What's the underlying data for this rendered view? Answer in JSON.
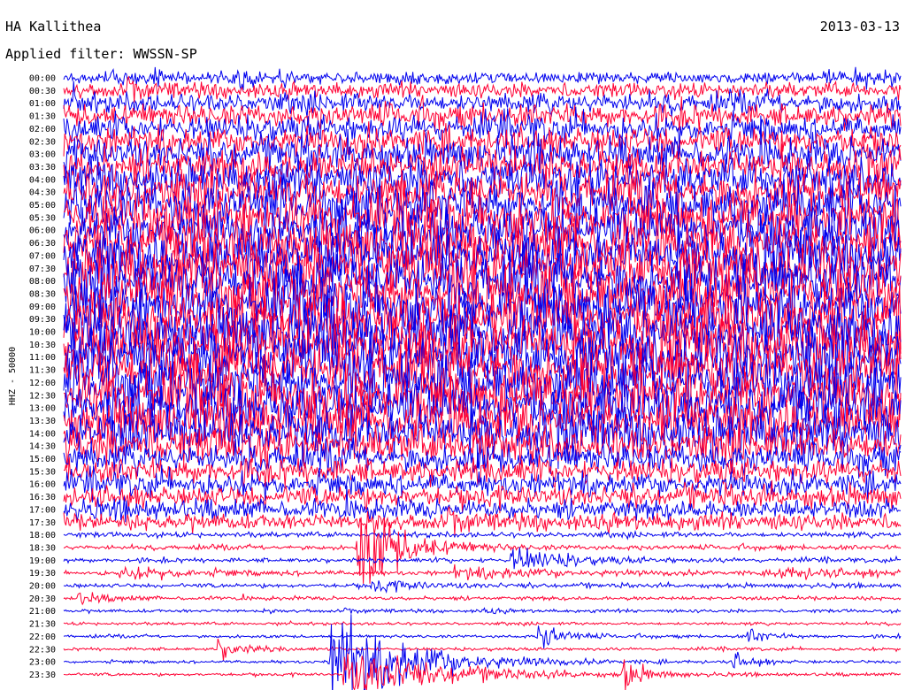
{
  "header": {
    "station": "HA Kallithea",
    "date": "2013-03-13",
    "filter": "Applied filter: WWSSN-SP"
  },
  "chart_data": {
    "type": "line",
    "title": "HA Kallithea",
    "ylabel": "HHZ - 50000",
    "hours": [
      "00:00",
      "00:30",
      "01:00",
      "01:30",
      "02:00",
      "02:30",
      "03:00",
      "03:30",
      "04:00",
      "04:30",
      "05:00",
      "05:30",
      "06:00",
      "06:30",
      "07:00",
      "07:30",
      "08:00",
      "08:30",
      "09:00",
      "09:30",
      "10:00",
      "10:30",
      "11:00",
      "11:30",
      "12:00",
      "12:30",
      "13:00",
      "13:30",
      "14:00",
      "14:30",
      "15:00",
      "15:30",
      "16:00",
      "16:30",
      "17:00",
      "17:30",
      "18:00",
      "18:30",
      "19:00",
      "19:30",
      "20:00",
      "20:30",
      "21:00",
      "21:30",
      "22:00",
      "22:30",
      "23:00",
      "23:30"
    ],
    "trace_colors": [
      "#0000ee",
      "#ff0033"
    ],
    "noise_amplitude": [
      0.8,
      1.0,
      1.3,
      1.5,
      1.7,
      1.9,
      2.1,
      2.3,
      2.5,
      2.7,
      3.0,
      3.1,
      3.2,
      3.3,
      3.4,
      3.5,
      3.6,
      3.6,
      3.6,
      3.6,
      3.6,
      3.6,
      3.6,
      3.6,
      3.6,
      3.5,
      3.4,
      3.2,
      3.0,
      2.5,
      1.9,
      1.6,
      1.5,
      1.4,
      1.3,
      1.1,
      0.35,
      0.3,
      0.28,
      0.28,
      0.28,
      0.25,
      0.22,
      0.2,
      0.2,
      0.2,
      0.2,
      0.2
    ],
    "events": [
      {
        "hour": "18:30",
        "minute": 10.5,
        "amplitude": 5.5,
        "decay_minutes": 1.5
      },
      {
        "hour": "19:00",
        "minute": 16.0,
        "amplitude": 1.5,
        "decay_minutes": 2.0
      },
      {
        "hour": "19:30",
        "minute": 2.0,
        "amplitude": 0.6,
        "decay_minutes": 3.0
      },
      {
        "hour": "19:30",
        "minute": 14.0,
        "amplitude": 0.7,
        "decay_minutes": 3.5
      },
      {
        "hour": "19:30",
        "minute": 25.5,
        "amplitude": 0.7,
        "decay_minutes": 2.5
      },
      {
        "hour": "20:00",
        "minute": 11.0,
        "amplitude": 0.6,
        "decay_minutes": 2.0
      },
      {
        "hour": "20:30",
        "minute": 0.5,
        "amplitude": 0.6,
        "decay_minutes": 1.0
      },
      {
        "hour": "21:00",
        "minute": 15.0,
        "amplitude": 0.4,
        "decay_minutes": 0.5
      },
      {
        "hour": "22:00",
        "minute": 17.0,
        "amplitude": 2.0,
        "decay_minutes": 0.8
      },
      {
        "hour": "22:00",
        "minute": 24.5,
        "amplitude": 1.2,
        "decay_minutes": 0.6
      },
      {
        "hour": "22:30",
        "minute": 5.5,
        "amplitude": 1.4,
        "decay_minutes": 0.8
      },
      {
        "hour": "23:00",
        "minute": 24.0,
        "amplitude": 1.1,
        "decay_minutes": 0.6
      },
      {
        "hour": "23:00",
        "minute": 9.5,
        "amplitude": 7.0,
        "decay_minutes": 2.5
      },
      {
        "hour": "23:30",
        "minute": 10.0,
        "amplitude": 3.5,
        "decay_minutes": 3.0
      },
      {
        "hour": "23:30",
        "minute": 20.0,
        "amplitude": 2.5,
        "decay_minutes": 0.6
      }
    ]
  }
}
